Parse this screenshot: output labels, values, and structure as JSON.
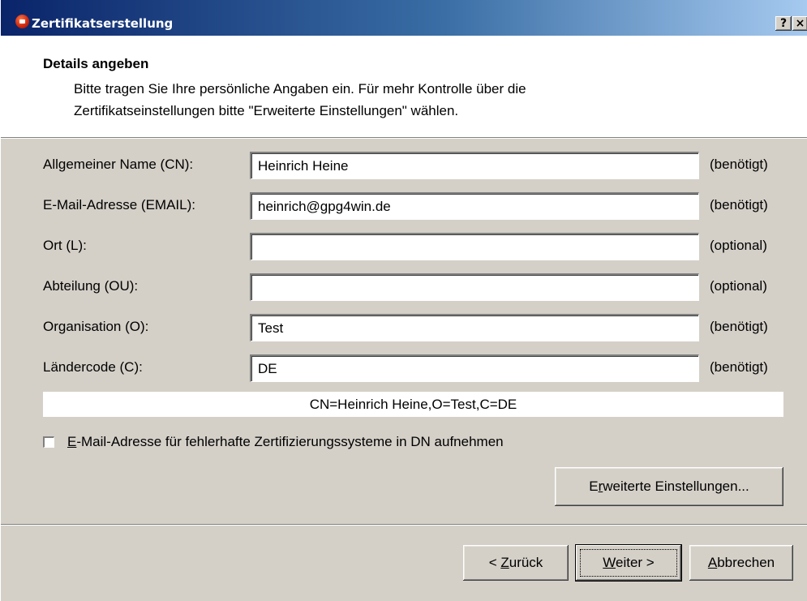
{
  "window": {
    "title": "Zertifikatserstellung",
    "help_button": "?",
    "close_button": "×",
    "icon": "app-key-icon"
  },
  "header": {
    "title": "Details angeben",
    "subtitle_line1": "Bitte tragen Sie Ihre persönliche Angaben ein. Für mehr Kontrolle über die",
    "subtitle_line2": "Zertifikatseinstellungen bitte \"Erweiterte Einstellungen\" wählen."
  },
  "form": {
    "fields": [
      {
        "label": "Allgemeiner Name (CN):",
        "value": "Heinrich Heine",
        "hint": "(benötigt)"
      },
      {
        "label": "E-Mail-Adresse (EMAIL):",
        "value": "heinrich@gpg4win.de",
        "hint": "(benötigt)"
      },
      {
        "label": "Ort (L):",
        "value": "",
        "hint": "(optional)"
      },
      {
        "label": "Abteilung (OU):",
        "value": "",
        "hint": "(optional)"
      },
      {
        "label": "Organisation (O):",
        "value": "Test",
        "hint": "(benötigt)"
      },
      {
        "label": "Ländercode (C):",
        "value": "DE",
        "hint": "(benötigt)"
      }
    ],
    "dn_preview": "CN=Heinrich Heine,O=Test,C=DE",
    "checkbox": {
      "accel": "E",
      "rest": "-Mail-Adresse für fehlerhafte Zertifizierungssysteme in DN aufnehmen",
      "checked": false
    },
    "advanced_button": {
      "pre": "E",
      "accel": "r",
      "post": "weiterte Einstellungen..."
    }
  },
  "footer": {
    "back": {
      "pre": "< ",
      "accel": "Z",
      "post": "urück"
    },
    "next": {
      "pre": "",
      "accel": "W",
      "post": "eiter >"
    },
    "cancel": {
      "pre": "",
      "accel": "A",
      "post": "bbrechen"
    }
  },
  "colors": {
    "title_bar_start": "#0a246a",
    "title_bar_end": "#a6caf0",
    "dialog_face": "#d4d0c8",
    "header_bg": "#ffffff"
  }
}
